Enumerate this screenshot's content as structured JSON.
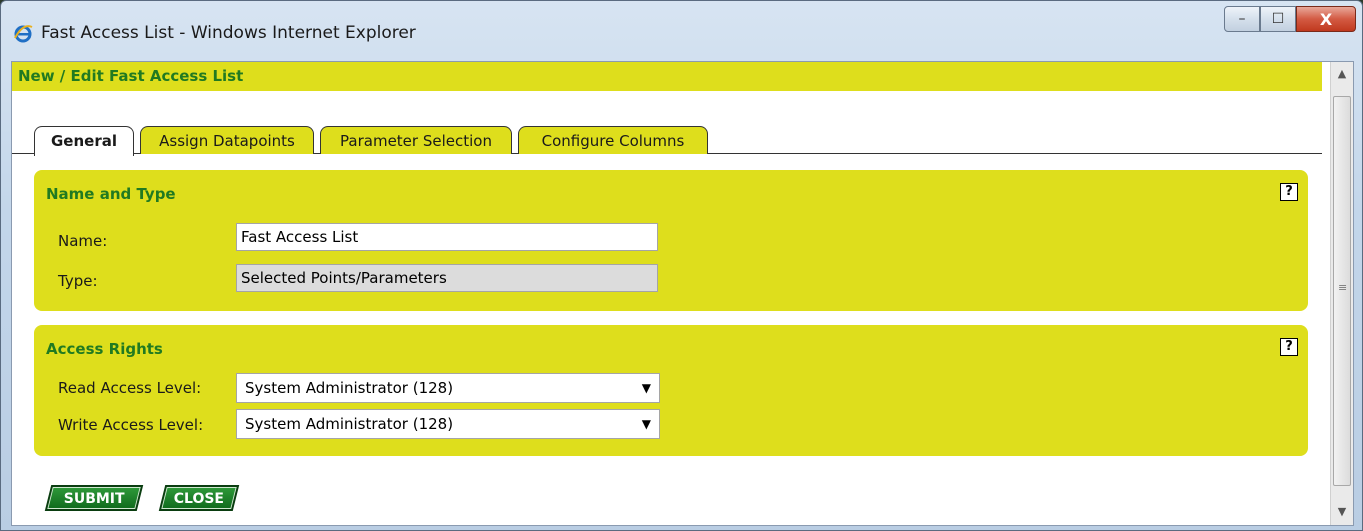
{
  "window": {
    "title": "Fast Access List - Windows Internet Explorer",
    "minimize": "–",
    "maximize": "☐",
    "close": "X"
  },
  "header": {
    "title": "New / Edit Fast Access List"
  },
  "tabs": [
    {
      "label": "General",
      "active": true
    },
    {
      "label": "Assign Datapoints",
      "active": false
    },
    {
      "label": "Parameter Selection",
      "active": false
    },
    {
      "label": "Configure Columns",
      "active": false
    }
  ],
  "name_and_type": {
    "title": "Name and Type",
    "help": "?",
    "name_label": "Name:",
    "name_value": "Fast Access List",
    "type_label": "Type:",
    "type_value": "Selected Points/Parameters"
  },
  "access_rights": {
    "title": "Access Rights",
    "help": "?",
    "read_label": "Read Access Level:",
    "read_value": "System Administrator (128)",
    "write_label": "Write Access Level:",
    "write_value": "System Administrator (128)"
  },
  "buttons": {
    "submit": "SUBMIT",
    "close": "CLOSE"
  },
  "colors": {
    "panel": "#dede1c",
    "heading": "#217a21",
    "button": "#1a7a2a"
  }
}
